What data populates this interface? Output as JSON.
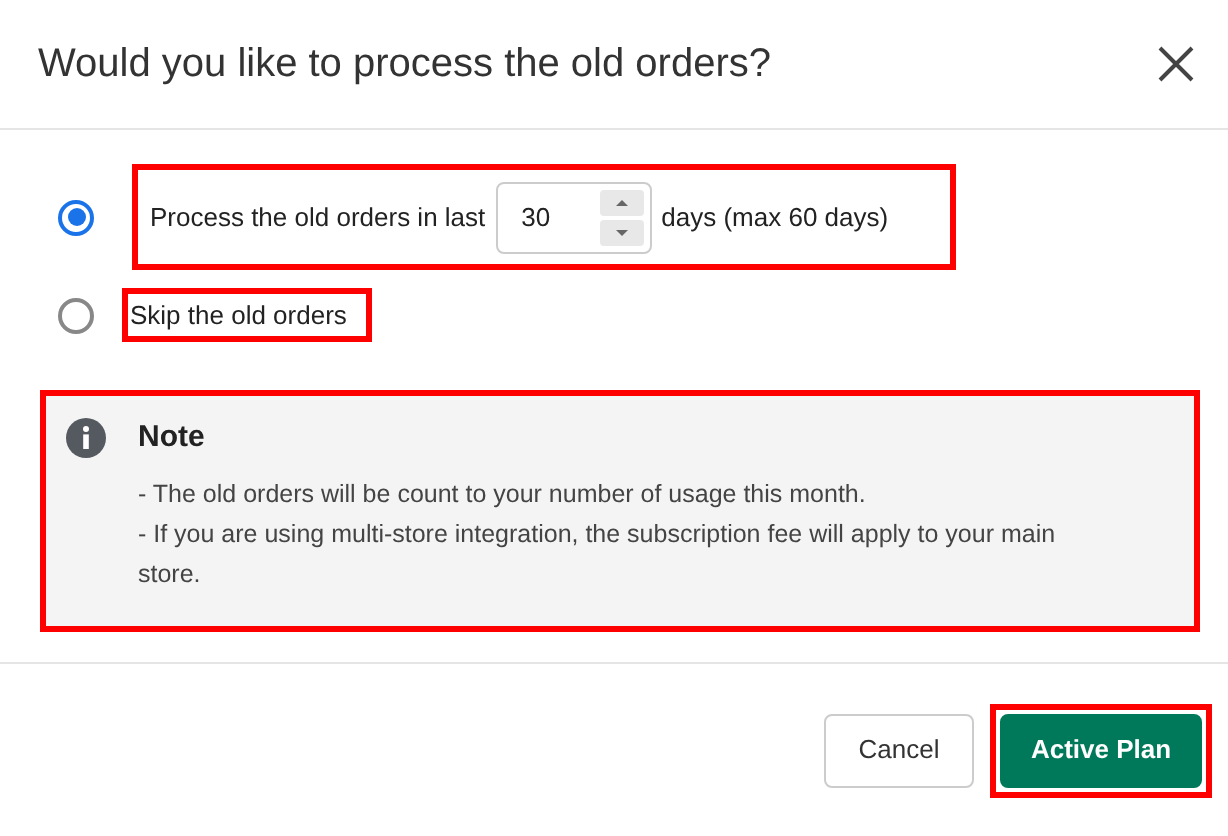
{
  "dialog": {
    "title": "Would you like to process the old orders?"
  },
  "options": [
    {
      "kind": "days",
      "selected": true,
      "highlighted": true,
      "label": "Process the old orders in last",
      "field_value": "30",
      "suffix": "days (max 60 days)"
    },
    {
      "kind": "plain",
      "selected": false,
      "highlighted": true,
      "label": "Skip the old orders"
    }
  ],
  "note": {
    "highlighted": true,
    "title": "Note",
    "lines": [
      "- The old orders will be count to your number of usage this month.",
      "- If you are using multi-store integration, the subscription fee will apply to your main store."
    ]
  },
  "buttons": [
    {
      "label": "Cancel",
      "kind": "secondary",
      "highlighted": false
    },
    {
      "label": "Active Plan",
      "kind": "primary",
      "highlighted": true
    }
  ]
}
